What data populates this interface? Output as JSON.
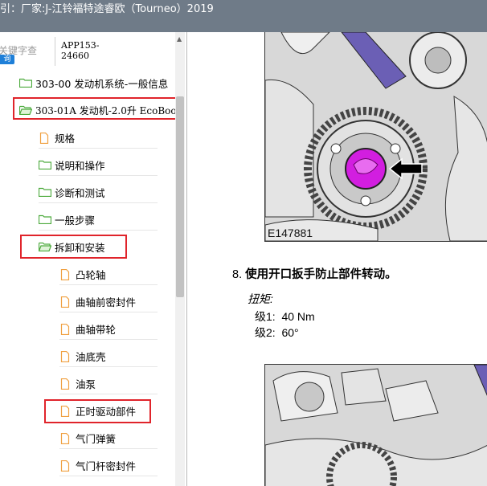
{
  "window": {
    "title": "引：厂家:J-江铃福特途睿欧（Tourneo）2019"
  },
  "search": {
    "placeholder_hint": "关键字查",
    "button_label": "询",
    "app_code": "APP153-\n24660"
  },
  "tree": {
    "items": [
      {
        "label": "303-00 发动机系统-一般信息",
        "icon": "folder-icon"
      },
      {
        "label": "303-01A 发动机-2.0升 EcoBoo",
        "icon": "folder-open-icon",
        "highlighted": true
      },
      {
        "label": "规格",
        "icon": "document-icon"
      },
      {
        "label": "说明和操作",
        "icon": "folder-icon"
      },
      {
        "label": "诊断和测试",
        "icon": "folder-icon"
      },
      {
        "label": "一般步骤",
        "icon": "folder-icon"
      },
      {
        "label": "拆卸和安装",
        "icon": "folder-open-icon",
        "highlighted": true
      },
      {
        "label": "凸轮轴",
        "icon": "document-icon"
      },
      {
        "label": "曲轴前密封件",
        "icon": "document-icon"
      },
      {
        "label": "曲轴带轮",
        "icon": "document-icon"
      },
      {
        "label": "油底壳",
        "icon": "document-icon"
      },
      {
        "label": "油泵",
        "icon": "document-icon"
      },
      {
        "label": "正时驱动部件",
        "icon": "document-icon",
        "highlighted": true
      },
      {
        "label": "气门弹簧",
        "icon": "document-icon"
      },
      {
        "label": "气门杆密封件",
        "icon": "document-icon"
      }
    ]
  },
  "content": {
    "figure1_label": "E147881",
    "step_number": "8.",
    "step_text": "使用开口扳手防止部件转动。",
    "torque_title": "扭矩:",
    "torque_levels": [
      {
        "label": "级1:",
        "value": "40 Nm"
      },
      {
        "label": "级2:",
        "value": "60°"
      }
    ]
  },
  "colors": {
    "titlebar": "#6f7b88",
    "highlight_box": "#e0242b",
    "folder_green": "#4caa3c",
    "document_orange": "#f0a040",
    "search_button": "#1e7fd8",
    "marker_magenta": "#d21ee0"
  }
}
